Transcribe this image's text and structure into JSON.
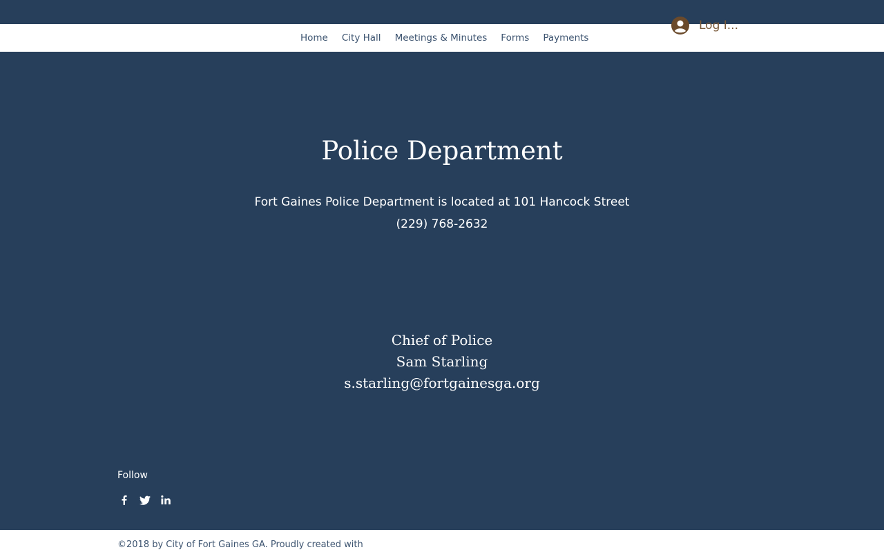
{
  "nav": {
    "items": [
      {
        "label": "Home"
      },
      {
        "label": "City Hall"
      },
      {
        "label": "Meetings & Minutes"
      },
      {
        "label": "Forms"
      },
      {
        "label": "Payments"
      }
    ],
    "login_label": "Log I..."
  },
  "main": {
    "title": "Police Department",
    "address": "Fort Gaines Police Department is located at 101 Hancock Street",
    "phone": "(229) 768-2632",
    "chief_title": "Chief of Police",
    "chief_name": "Sam Starling",
    "chief_email": "s.starling@fortgainesga.org"
  },
  "follow": {
    "label": "Follow",
    "icons": [
      "facebook-icon",
      "twitter-icon",
      "linkedin-icon"
    ]
  },
  "footer": {
    "text": "©2018 by City of Fort Gaines GA. Proudly created with"
  },
  "colors": {
    "background": "#273f5b",
    "nav_text": "#3d5470",
    "login_text": "#7a5a3a",
    "avatar": "#6b4a2b"
  }
}
